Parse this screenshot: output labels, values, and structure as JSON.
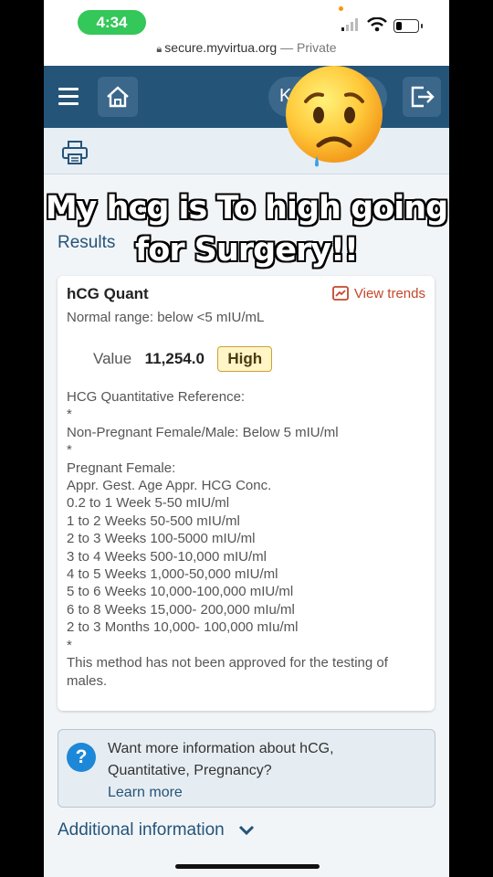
{
  "status_bar": {
    "time": "4:34"
  },
  "url_bar": {
    "domain": "secure.myvirtua.org",
    "separator": "—",
    "mode": "Private"
  },
  "header": {
    "user_initial": "K"
  },
  "breadcrumb": {
    "results_link": "Results"
  },
  "result_card": {
    "title": "hCG Quant",
    "trends_link": "View trends",
    "normal_range": "Normal range: below <5 mIU/mL",
    "value_label": "Value",
    "value": "11,254.0",
    "flag": "High",
    "reference_lines": [
      "HCG Quantitative Reference:",
      "*",
      "Non-Pregnant Female/Male: Below 5 mIU/ml",
      "*",
      "Pregnant Female:",
      "Appr. Gest. Age Appr. HCG Conc.",
      "0.2 to 1 Week 5-50 mIU/ml",
      "1 to 2 Weeks 50-500 mIU/ml",
      "2 to 3 Weeks 100-5000 mIU/ml",
      "3 to 4 Weeks 500-10,000 mIU/ml",
      "4 to 5 Weeks 1,000-50,000 mIU/ml",
      "5 to 6 Weeks 10,000-100,000 mIU/ml",
      "6 to 8 Weeks 15,000- 200,000 mIu/ml",
      "2 to 3 Months 10,000- 100,000 mIu/ml",
      "*"
    ],
    "method_note": "This method has not been approved for the testing of males."
  },
  "info_box": {
    "question": "Want more information about hCG, Quantitative, Pregnancy?",
    "link": "Learn more"
  },
  "additional_info": "Additional information",
  "overlay_caption": {
    "line1": "My hcg is To high going",
    "line2": "for Surgery!!"
  },
  "colors": {
    "header_bg": "#255479",
    "link": "#255479",
    "trends": "#c4472b",
    "high_badge_bg": "#fff5c6",
    "time_pill": "#34c759"
  },
  "icons": [
    "hamburger-menu-icon",
    "home-icon",
    "chevron-down-icon",
    "logout-icon",
    "printer-icon",
    "trend-chart-icon",
    "question-icon",
    "worried-face-emoji"
  ]
}
